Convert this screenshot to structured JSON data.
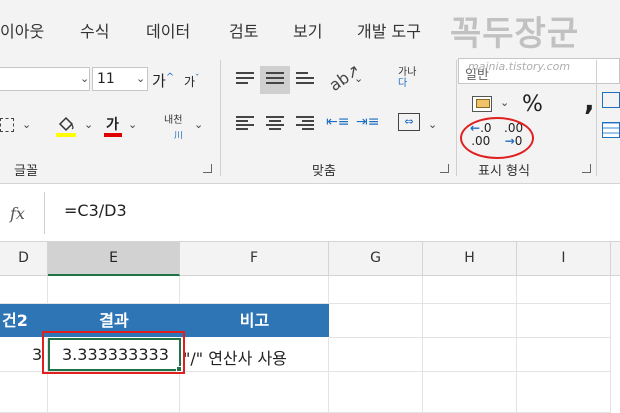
{
  "menu": {
    "tabs": [
      "이아웃",
      "수식",
      "데이터",
      "검토",
      "보기",
      "개발 도구"
    ],
    "watermark": "꼭두장군"
  },
  "ribbon": {
    "font": {
      "font_name": "",
      "font_size": "11",
      "grow_font": "가",
      "shrink_font": "가",
      "font_color_letter": "가",
      "phonetic_label": "내천",
      "group_label": "글꼴"
    },
    "alignment": {
      "wrap_text_label": "가나",
      "wrap_text_label_2": "다",
      "group_label": "맞춤"
    },
    "number": {
      "format_value": "일반",
      "url_text": "mainia.tistory.com",
      "percent": "%",
      "comma": ",",
      "increase_decimal_top": ".0",
      "increase_decimal_bottom": ".00",
      "decrease_decimal_top": ".00",
      "decrease_decimal_bottom": "0",
      "group_label": "표시 형식"
    }
  },
  "formula_bar": {
    "fx_label": "fx",
    "formula": "=C3/D3"
  },
  "grid": {
    "columns": [
      "D",
      "E",
      "F",
      "G",
      "H",
      "I"
    ],
    "header_row": [
      "건2",
      "결과",
      "비고"
    ],
    "data_row": {
      "d_value": "3",
      "e_value": "3.333333333",
      "f_value": "\"/\" 연산사 사용"
    }
  },
  "colors": {
    "header_fill": "#2e75b6",
    "active_border": "#217346",
    "highlight": "#e02020"
  }
}
